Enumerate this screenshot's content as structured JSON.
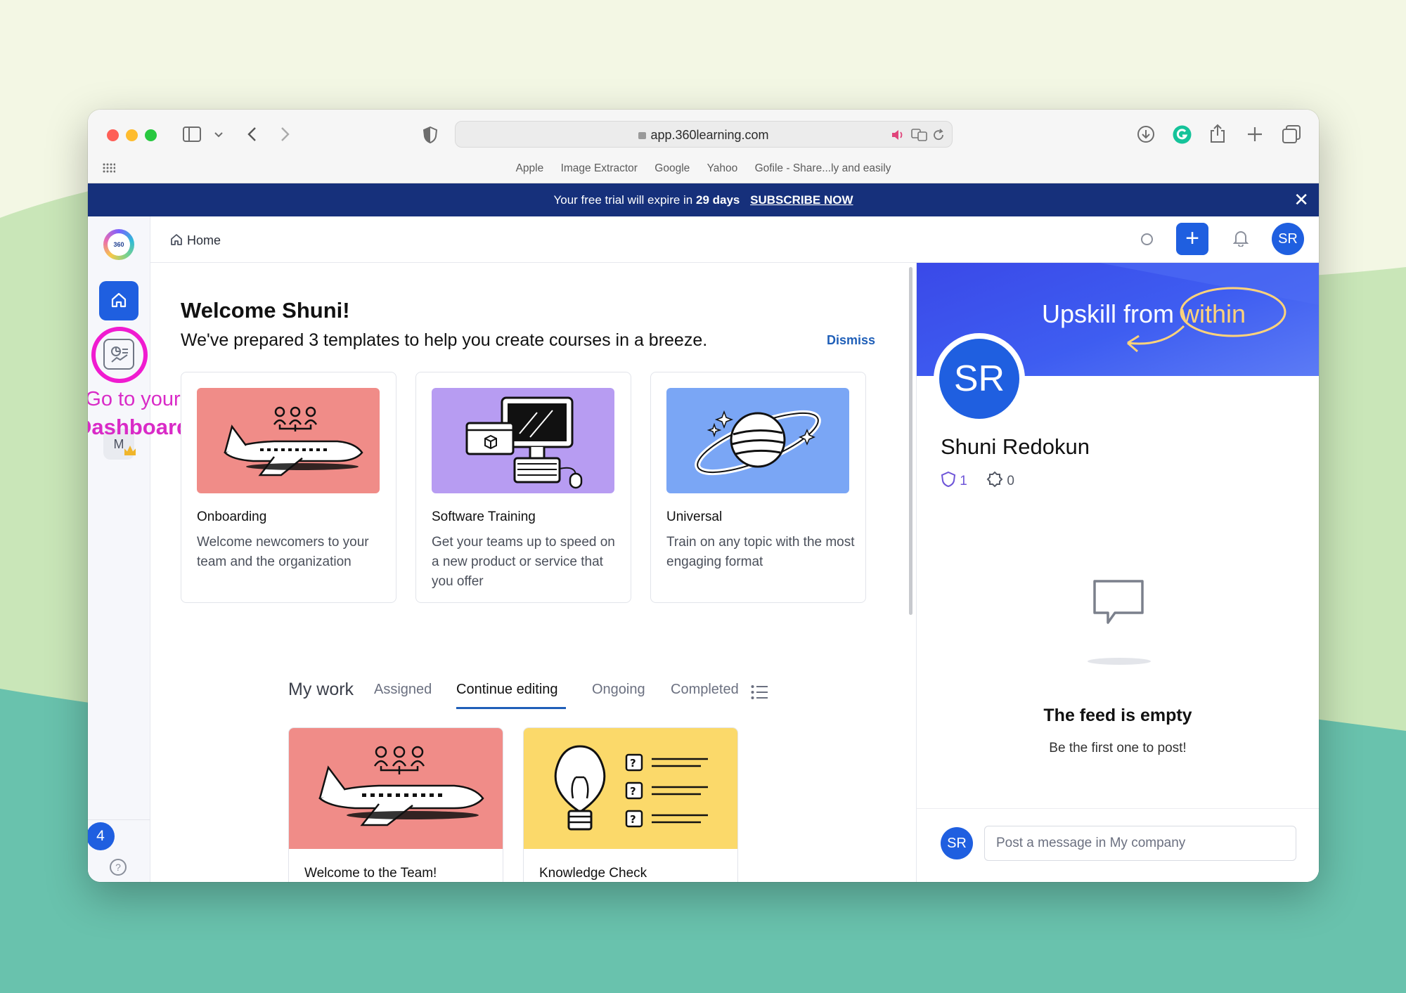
{
  "browser": {
    "url": "app.360learning.com",
    "bookmarks": [
      "Apple",
      "Image Extractor",
      "Google",
      "Yahoo",
      "Gofile - Share...ly and easily"
    ]
  },
  "trial_banner": {
    "text_before": "Your free trial will expire in",
    "days": "29 days",
    "cta": "SUBSCRIBE NOW"
  },
  "sidebar": {
    "logo_text": "360",
    "home_icon": "home-icon",
    "dashboard_icon": "dashboard-icon",
    "workspace_initial": "M",
    "badge_count": "4",
    "help_icon": "?"
  },
  "annotation": {
    "line1": "Go to your",
    "line2": "Dashboard",
    "color": "#f01bd0"
  },
  "topbar": {
    "breadcrumb": "Home",
    "user_initials": "SR"
  },
  "welcome": {
    "title": "Welcome Shuni!",
    "subtitle": "We've prepared 3 templates to help you create courses in a breeze.",
    "dismiss": "Dismiss"
  },
  "templates": [
    {
      "title": "Onboarding",
      "desc": "Welcome newcomers to your team and the organization",
      "color": "#f08c88"
    },
    {
      "title": "Software Training",
      "desc": "Get your teams up to speed on a new product or service that you offer",
      "color": "#b79cf2"
    },
    {
      "title": "Universal",
      "desc": "Train on any topic with the most engaging format",
      "color": "#7aa6f5"
    }
  ],
  "work_tabs": {
    "heading": "My work",
    "assigned": "Assigned",
    "continue_editing": "Continue editing",
    "ongoing": "Ongoing",
    "completed": "Completed"
  },
  "work_cards": [
    {
      "title": "Welcome to the Team!",
      "color": "#f08c88"
    },
    {
      "title": "Knowledge Check",
      "color": "#fbd96a"
    }
  ],
  "profile": {
    "cover_text": "Upskill from",
    "cover_highlight": "within",
    "initials": "SR",
    "name": "Shuni Redokun",
    "stat1": "1",
    "stat2": "0"
  },
  "feed": {
    "title": "The feed is empty",
    "subtitle": "Be the first one to post!",
    "post_placeholder": "Post a message in My company"
  },
  "colors": {
    "brand_blue": "#1f5fe0",
    "banner_navy": "#16307b"
  }
}
